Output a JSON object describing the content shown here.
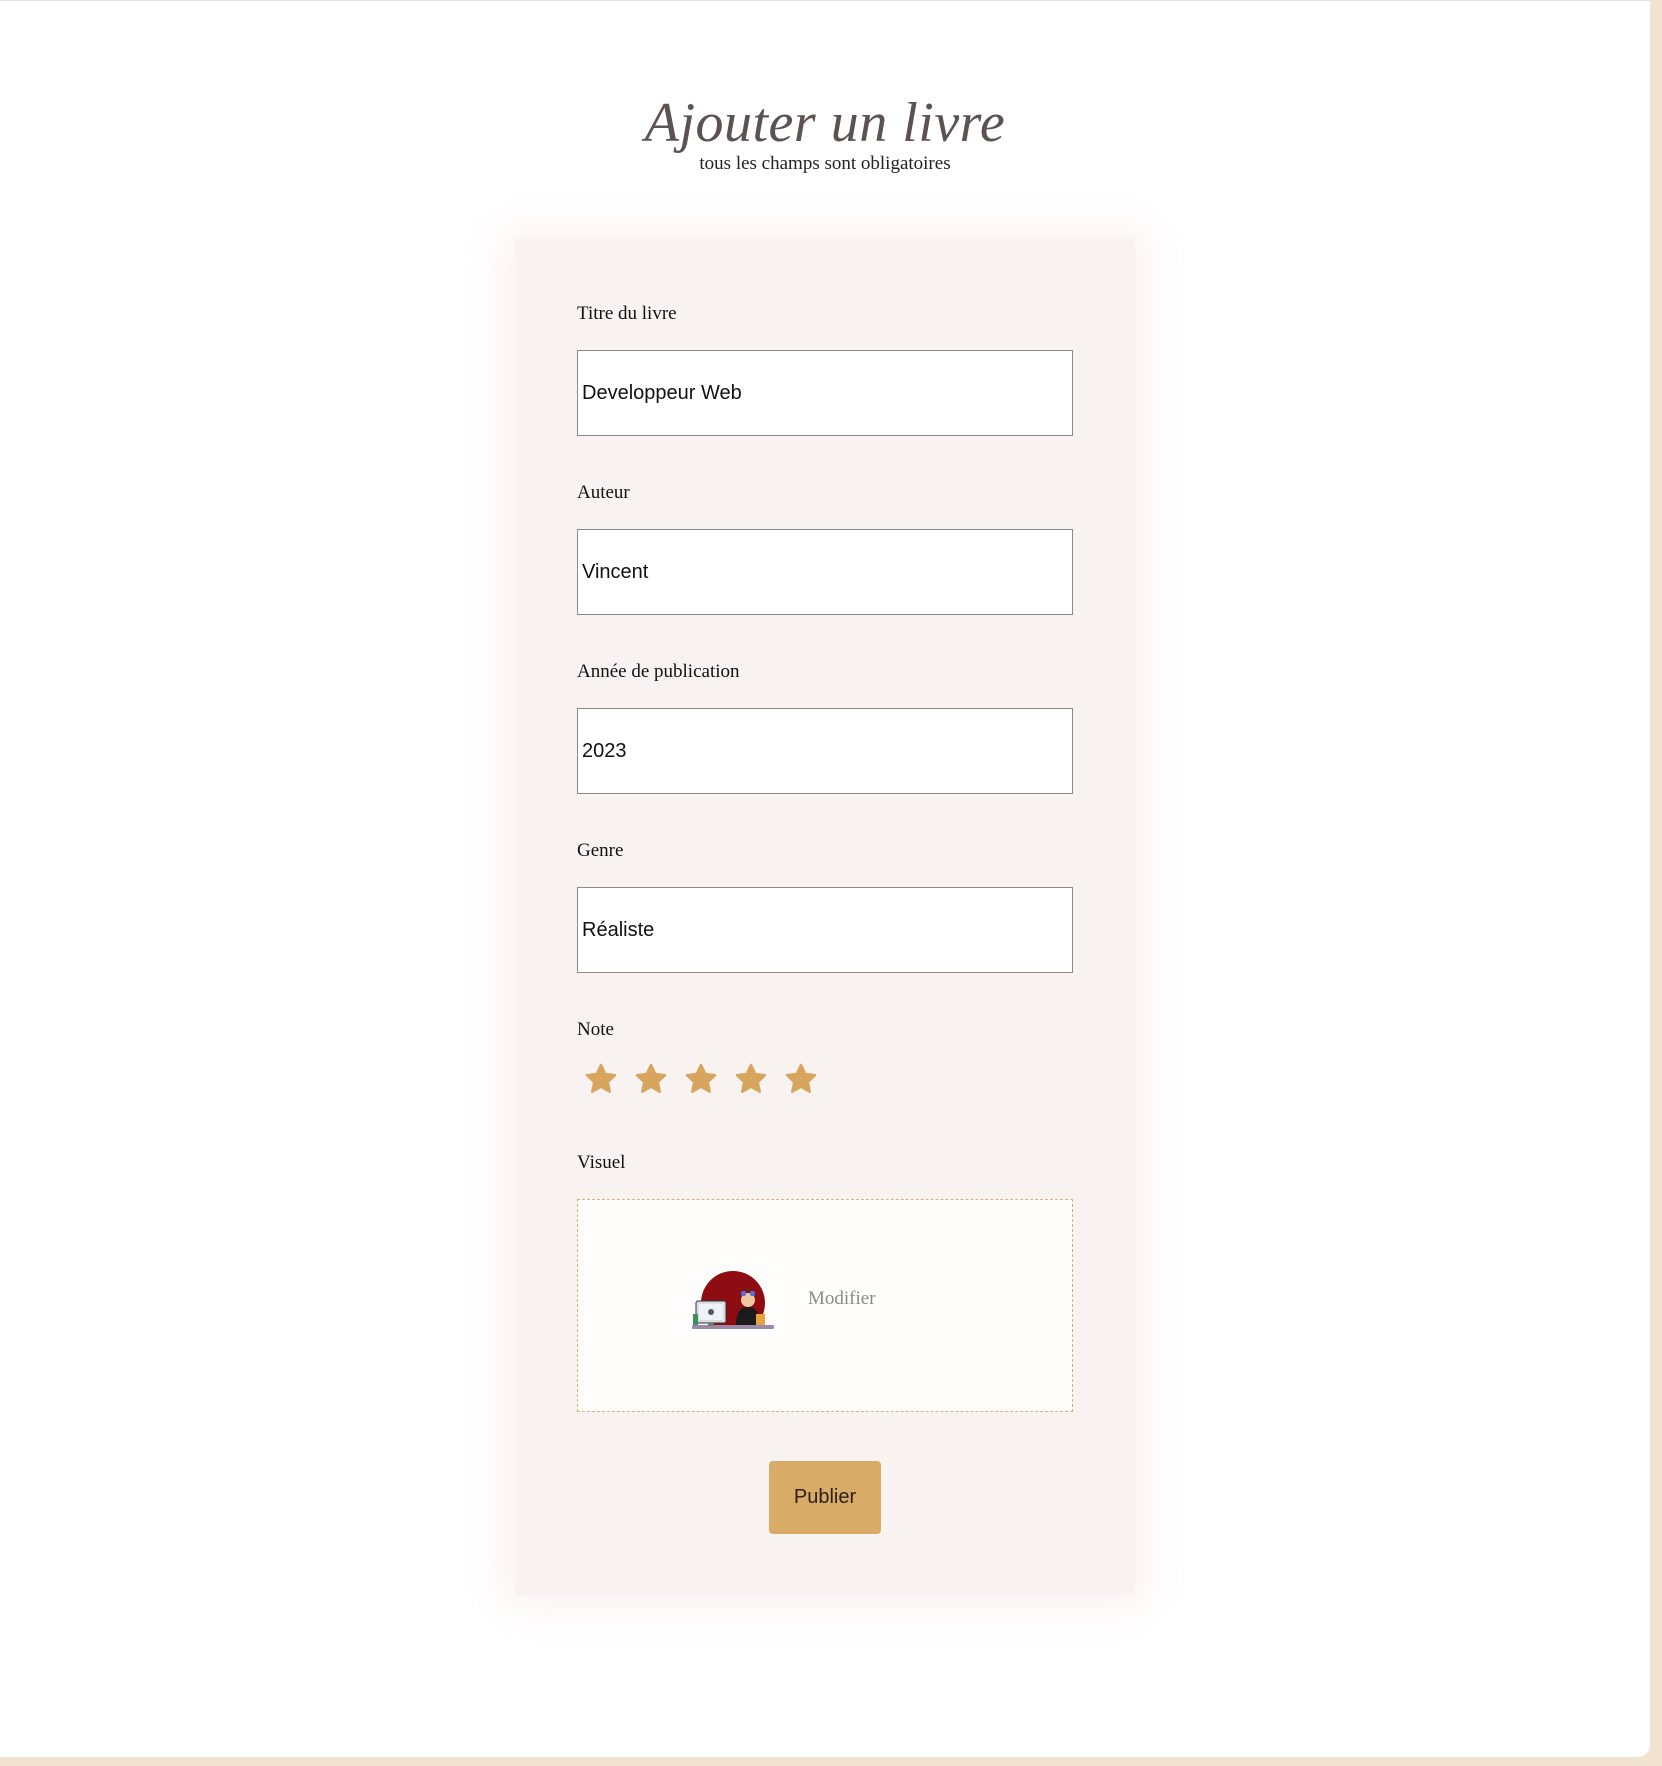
{
  "header": {
    "title": "Ajouter un livre",
    "subtitle": "tous les champs sont obligatoires"
  },
  "form": {
    "title_field": {
      "label": "Titre du livre",
      "value": "Developpeur Web"
    },
    "author_field": {
      "label": "Auteur",
      "value": "Vincent"
    },
    "year_field": {
      "label": "Année de publication",
      "value": "2023"
    },
    "genre_field": {
      "label": "Genre",
      "value": "Réaliste"
    },
    "rating": {
      "label": "Note",
      "value": 5,
      "max": 5,
      "star_color": "#d8a55e",
      "icon": "star-icon"
    },
    "visual": {
      "label": "Visuel",
      "modify_label": "Modifier",
      "image_icon": "developer-at-desk-illustration"
    },
    "publish_label": "Publier"
  },
  "colors": {
    "accent": "#d8ac66",
    "title": "#5c5252",
    "card_background": "#f8f3f1",
    "frame": "#f2e2d0"
  }
}
